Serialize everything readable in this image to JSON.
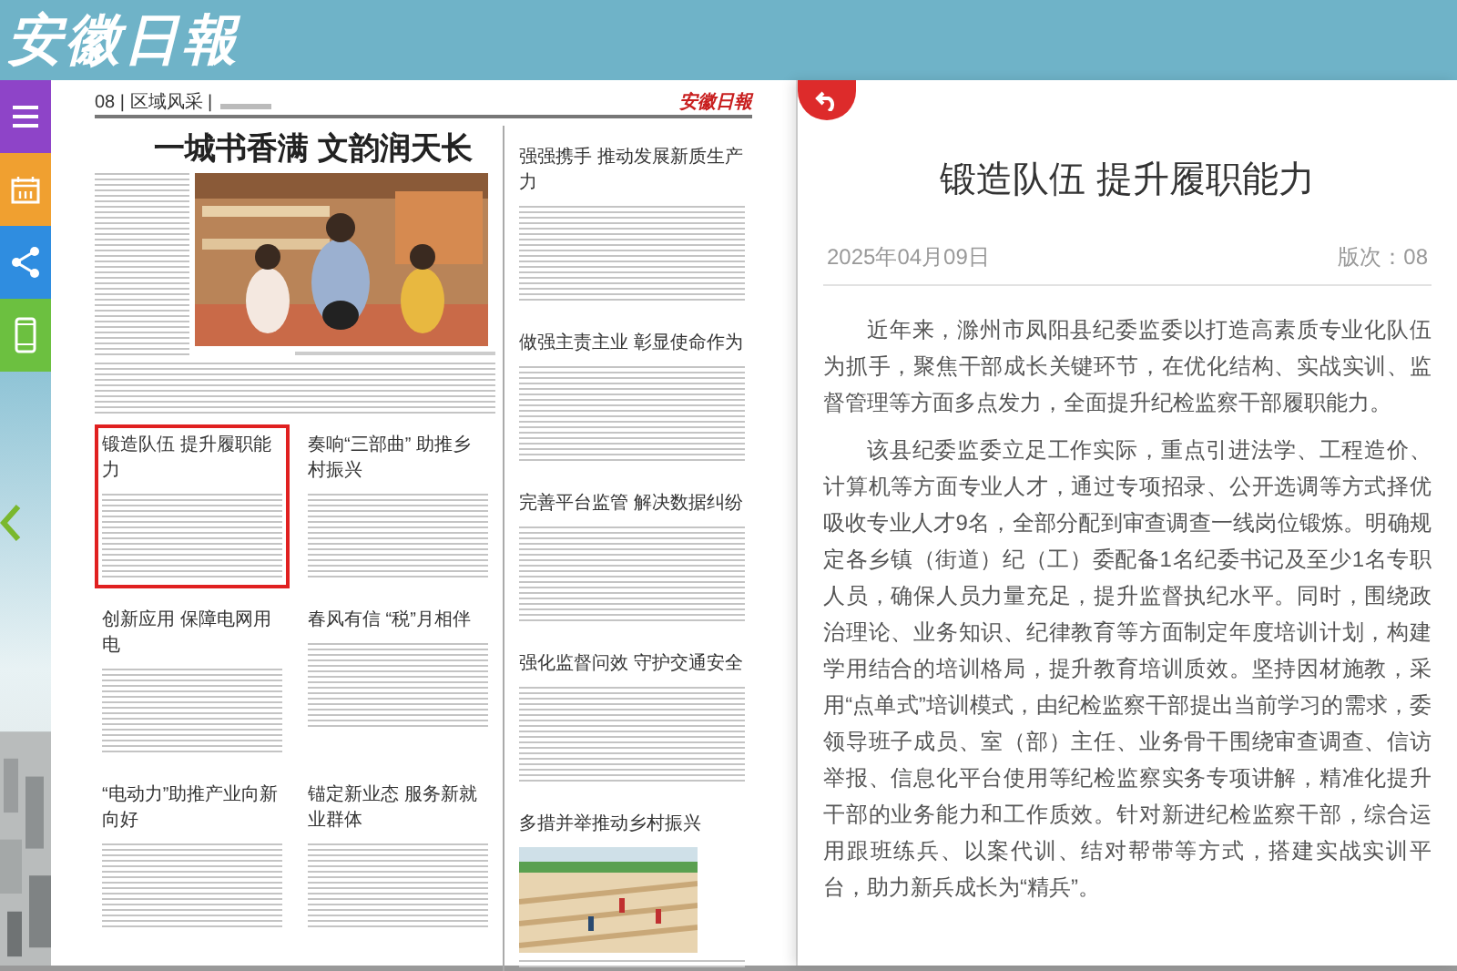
{
  "header": {
    "logo": "安徽日報"
  },
  "sidebar": {
    "buttons": [
      {
        "kind": "menu",
        "color": "#8e44c8"
      },
      {
        "kind": "calendar",
        "color": "#f0a030"
      },
      {
        "kind": "share",
        "color": "#2f8de0"
      },
      {
        "kind": "phone",
        "color": "#6cc040"
      }
    ]
  },
  "newspaper": {
    "page_label": "08 | 区域风采 |",
    "masthead": "安徽日報",
    "lead_headline": "一城书香满 文韵润天长",
    "grid_articles": [
      {
        "headline": "锻造队伍 提升履职能力",
        "selected": true
      },
      {
        "headline": "奏响“三部曲” 助推乡村振兴",
        "selected": false
      },
      {
        "headline": "创新应用 保障电网用电",
        "selected": false
      },
      {
        "headline": "春风有信 “税”月相伴",
        "selected": false
      },
      {
        "headline": "“电动力”助推产业向新向好",
        "selected": false
      },
      {
        "headline": "锚定新业态 服务新就业群体",
        "selected": false
      }
    ],
    "side_articles": [
      {
        "headline": "强强携手 推动发展新质生产力",
        "selected": false
      },
      {
        "headline": "做强主责主业 彰显使命作为",
        "selected": false
      },
      {
        "headline": "完善平台监管 解决数据纠纷",
        "selected": false
      },
      {
        "headline": "强化监督问效 守护交通安全",
        "selected": false
      },
      {
        "headline": "多措并举推动乡村振兴",
        "selected": false
      }
    ]
  },
  "article": {
    "title": "锻造队伍 提升履职能力",
    "date": "2025年04月09日",
    "edition": "版次：08",
    "paragraphs": [
      "近年来，滁州市凤阳县纪委监委以打造高素质专业化队伍为抓手，聚焦干部成长关键环节，在优化结构、实战实训、监督管理等方面多点发力，全面提升纪检监察干部履职能力。",
      "该县纪委监委立足工作实际，重点引进法学、工程造价、计算机等方面专业人才，通过专项招录、公开选调等方式择优吸收专业人才9名，全部分配到审查调查一线岗位锻炼。明确规定各乡镇（街道）纪（工）委配备1名纪委书记及至少1名专职人员，确保人员力量充足，提升监督执纪水平。同时，围绕政治理论、业务知识、纪律教育等方面制定年度培训计划，构建学用结合的培训格局，提升教育培训质效。坚持因材施教，采用“点单式”培训模式，由纪检监察干部提出当前学习的需求，委领导班子成员、室（部）主任、业务骨干围绕审查调查、信访举报、信息化平台使用等纪检监察实务专项讲解，精准化提升干部的业务能力和工作质效。针对新进纪检监察干部，综合运用跟班练兵、以案代训、结对帮带等方式，搭建实战实训平台，助力新兵成长为“精兵”。"
    ]
  }
}
